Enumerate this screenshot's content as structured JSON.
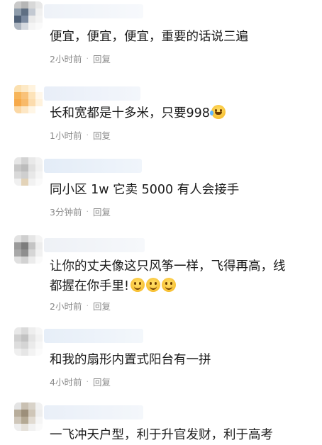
{
  "comments": [
    {
      "text": "便宜，便宜，便宜，重要的话说三遍",
      "time": "2小时前",
      "reply": "回复",
      "emoji_count": 0,
      "avatar_colors": [
        "#c9c9c9",
        "#b6b6b6",
        "#d8d8d8",
        "#e8e8e8",
        "#8e9cab",
        "#5f6f83",
        "#c3c9d2",
        "#f0f0f0",
        "#4f6077",
        "#7b8aa0",
        "#eaeaea",
        "#f3f3f3",
        "#aeb6c1",
        "#d5d9df",
        "#f5f5f5",
        "#fafafa"
      ]
    },
    {
      "text": "长和宽都是十多米，只要998",
      "time": "1小时前",
      "reply": "回复",
      "emoji": "laughing-crying",
      "avatar_colors": [
        "#fbe0b0",
        "#fde9c6",
        "#fff3de",
        "#ffffff",
        "#f7b55a",
        "#f9c27a",
        "#fde3b9",
        "#fff7ea",
        "#f6a94a",
        "#f8ba6a",
        "#fcdcae",
        "#fff2dc",
        "#fbd8a5",
        "#fde7c5",
        "#fff6e6",
        "#ffffff"
      ]
    },
    {
      "text": "同小区 1w   它卖 5000   有人会接手",
      "time": "3分钟前",
      "reply": "回复",
      "emoji_count": 0,
      "avatar_colors": [
        "#e6e6e6",
        "#d3d3d3",
        "#e9e9e9",
        "#f2f2f2",
        "#c8c8c8",
        "#bcbcbc",
        "#e0e0e0",
        "#f0f0f0",
        "#d9d9d9",
        "#cfcfcf",
        "#e8e8e8",
        "#f5f5f5",
        "#f0f0f0",
        "#e3d3b8",
        "#f2f2f2",
        "#fafafa"
      ]
    },
    {
      "text": "让你的丈夫像这只风筝一样，飞得再高，线都握在你手里!",
      "time": "2小时前",
      "reply": "回复",
      "emoji_count": 3,
      "avatar_colors": [
        "#e2e2e2",
        "#cfcfcf",
        "#e6e6e6",
        "#f4f4f4",
        "#9a9a9a",
        "#7d7d7d",
        "#c4c4c4",
        "#ededed",
        "#a8a8a8",
        "#8f8f8f",
        "#d6d6d6",
        "#f1f1f1",
        "#e0e0e0",
        "#d2d2d2",
        "#ececec",
        "#fafafa"
      ]
    },
    {
      "text": "和我的扇形内置式阳台有一拼",
      "time": "4小时前",
      "reply": "回复",
      "emoji_count": 0,
      "avatar_colors": [
        "#e8e8e8",
        "#dadada",
        "#eeeeee",
        "#f6f6f6",
        "#d0d0d0",
        "#c2c2c2",
        "#e4e4e4",
        "#f2f2f2",
        "#dddddd",
        "#d5d5d5",
        "#ebebeb",
        "#f7f7f7",
        "#efefef",
        "#e6e6e6",
        "#f3f3f3",
        "#fbfbfb"
      ]
    },
    {
      "text": "一飞冲天户型，利于升官发财，利于高考",
      "time": "",
      "reply": "",
      "emoji_count": 0,
      "avatar_colors": [
        "#e4e4e4",
        "#c9c0b2",
        "#d9d3c9",
        "#f1f1f1",
        "#b8ad9b",
        "#9c8f7a",
        "#cfc6b8",
        "#eeeeee",
        "#cfc7ba",
        "#b4a994",
        "#e1dbd2",
        "#f5f5f5",
        "#eeeeee",
        "#e5e1da",
        "#f2f2f2",
        "#fafafa"
      ]
    }
  ],
  "name_blur_colors": [
    "#f0f3f7",
    "#eef2f7",
    "#e7eef7",
    "#f1f4f8",
    "#eef1f6",
    "#eef2f8"
  ]
}
